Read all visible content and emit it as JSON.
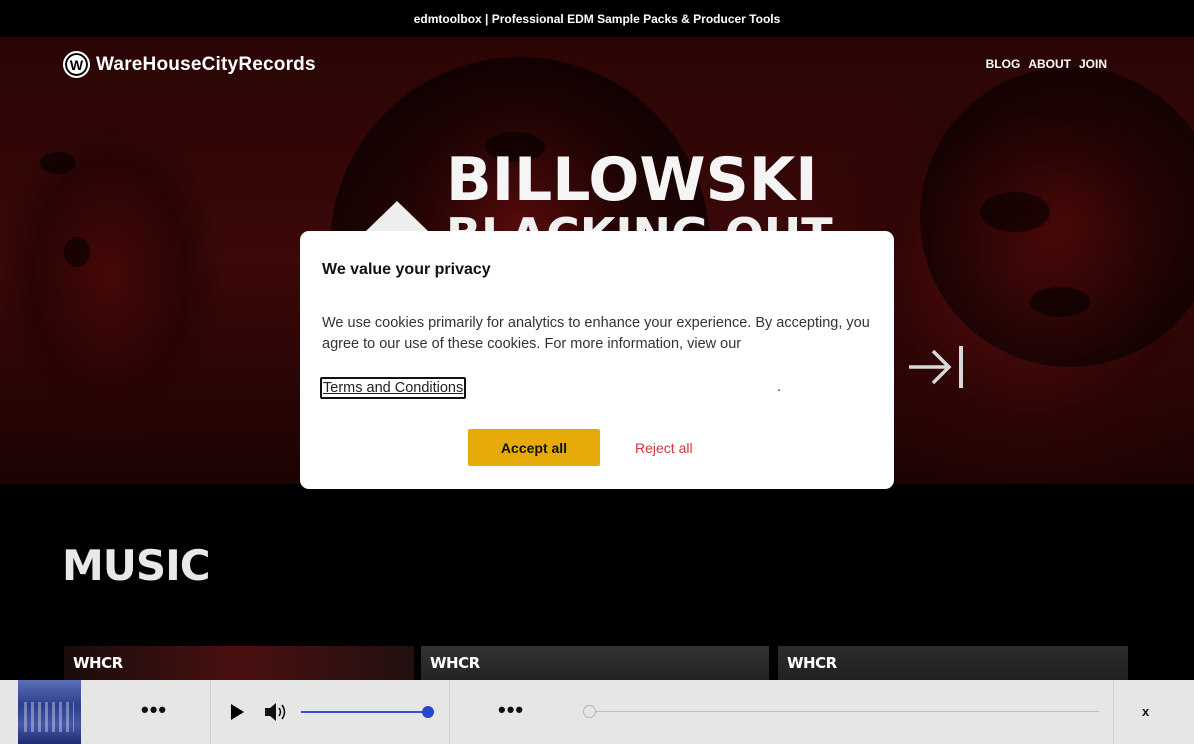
{
  "top_banner": {
    "text": "edmtoolbox | Professional EDM Sample Packs & Producer Tools"
  },
  "nav": {
    "logo_letter": "W",
    "brand": "WareHouseCityRecords",
    "links": [
      "BLOG",
      "ABOUT",
      "JOIN"
    ]
  },
  "hero": {
    "title": "BILLOWSKI",
    "subtitle": "BLACKING OUT",
    "next_icon": "arrow-right-to-bar-icon"
  },
  "music": {
    "heading": "MUSIC",
    "cards": [
      "WHCR",
      "WHCR",
      "WHCR"
    ]
  },
  "cookie_modal": {
    "title": "We value your privacy",
    "body": "We use cookies primarily for analytics to enhance your experience. By accepting, you agree to our use of these cookies. For more information, view our",
    "link": "Terms and Conditions",
    "link_suffix": ".",
    "accept_label": "Accept all",
    "reject_label": "Reject all",
    "accept_color": "#E6AB08",
    "reject_color": "#D8343C"
  },
  "player": {
    "menu_left": "•••",
    "menu_right": "•••",
    "play_icon": "play-icon",
    "volume_icon": "volume-icon",
    "volume_level": 1.0,
    "seek_position": 0.0,
    "close_label": "x",
    "accent_color": "#2848CC"
  }
}
